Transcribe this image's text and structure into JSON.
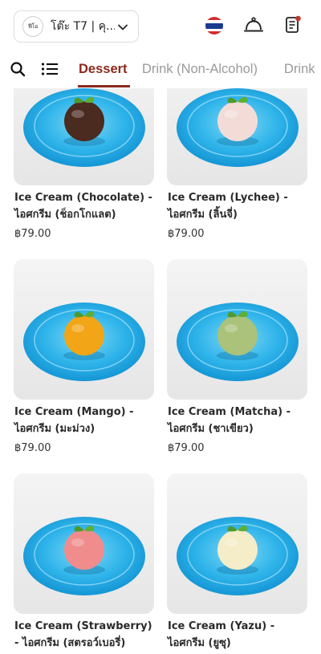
{
  "header": {
    "logo_text": "ฟีโอ",
    "table_label": "โต๊ะ T7 | คุ...",
    "flag_colors": [
      "#d32f2f",
      "#ffffff",
      "#1a3a8f",
      "#ffffff",
      "#d32f2f"
    ],
    "accent_color": "#8c2a1c",
    "notification_dot_color": "#c0392b"
  },
  "tabs": {
    "items": [
      {
        "label": "Dessert",
        "active": true
      },
      {
        "label": "Drink (Non-Alcohol)",
        "active": false
      },
      {
        "label": "Drink",
        "active": false
      }
    ]
  },
  "products": [
    {
      "name": "Ice Cream (Chocolate) - ไอศกรีม (ช็อกโกแลต)",
      "price": "฿79.00",
      "scoop_color": "#4b2a1f"
    },
    {
      "name": "Ice Cream (Lychee) - ไอศกรีม (ลิ้นจี่)",
      "price": "฿79.00",
      "scoop_color": "#f3dcd8"
    },
    {
      "name": "Ice Cream (Mango) - ไอศกรีม (มะม่วง)",
      "price": "฿79.00",
      "scoop_color": "#f2a516"
    },
    {
      "name": "Ice Cream (Matcha) - ไอศกรีม (ชาเขียว)",
      "price": "฿79.00",
      "scoop_color": "#aac27a"
    },
    {
      "name": "Ice Cream (Strawberry) - ไอศกรีม (สตรอว์เบอรี่)",
      "price": "",
      "scoop_color": "#f08c8c"
    },
    {
      "name": "Ice Cream (Yazu) - ไอศกรีม (ยูซุ)",
      "price": "",
      "scoop_color": "#f5ecc8"
    }
  ]
}
